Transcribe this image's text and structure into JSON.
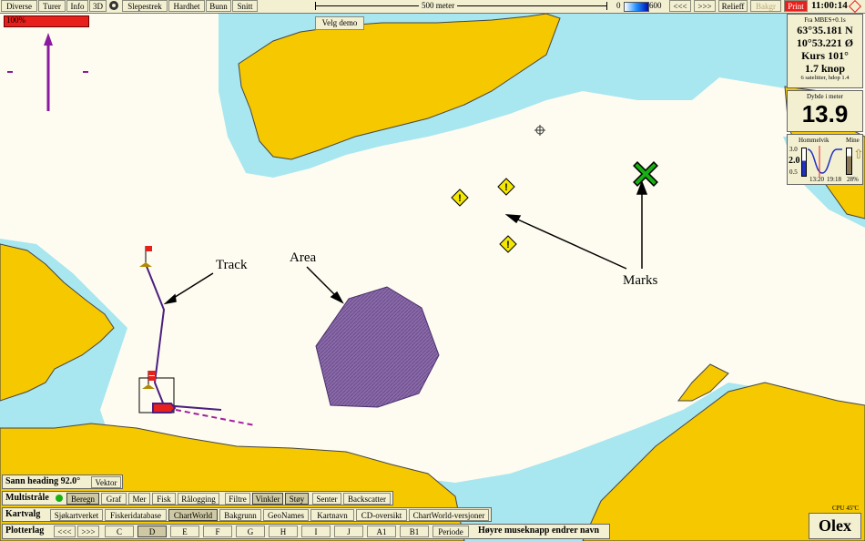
{
  "colors": {
    "land": "#f5c800",
    "shallow": "#a8e6f0",
    "water": "#fefcf0",
    "area": "#8a6aa8",
    "track": "#4a1f7f",
    "panel": "#f3f0d2",
    "red": "#e8201c",
    "green": "#17b012"
  },
  "topbar": {
    "menu": [
      "Diverse",
      "Turer",
      "Info",
      "3D",
      "Slepestrek",
      "Hardhet",
      "Bunn",
      "Snitt"
    ],
    "scale_label": "500 meter",
    "depth_min": "0",
    "depth_max": "600",
    "prev": "<<<",
    "next": ">>>",
    "relieff": "Relieff",
    "bakgr": "Bakgr",
    "print": "Print",
    "clock": "11:00:14"
  },
  "zoom_label": "100%",
  "demo_button": "Velg demo",
  "gps": {
    "line1": "Fra MBES+0.1s",
    "lat": "63°35.181 N",
    "lon": "10°53.221 Ø",
    "course": "Kurs 101°",
    "speed": "1.7 knop",
    "sats": "6 satelitter, hdop 1.4"
  },
  "depth": {
    "label": "Dybde i meter",
    "value": "13.9"
  },
  "tide": {
    "place": "Hommelvik",
    "moon": "Mine",
    "v_top": "3.0",
    "v_mid": "2.0",
    "v_bot": "0.5",
    "t1": "13:20",
    "t2": "19:18",
    "pct": "28%"
  },
  "annotations": {
    "track": "Track",
    "area": "Area",
    "marks": "Marks"
  },
  "heading": {
    "label": "Sann heading 92.0°",
    "vektor": "Vektor"
  },
  "multistraale": {
    "label": "Multistråle",
    "items": [
      "Beregn",
      "Graf",
      "Mer",
      "Fisk",
      "Rålogging",
      "Filtre",
      "Vinkler",
      "Støy",
      "Senter",
      "Backscatter"
    ]
  },
  "kartvalg": {
    "label": "Kartvalg",
    "items": [
      "Sjøkartverket",
      "Fiskeridatabase",
      "ChartWorld",
      "Bakgrunn",
      "GeoNames",
      "Kartnavn",
      "CD-oversikt",
      "ChartWorld-versjoner"
    ]
  },
  "plotterlag": {
    "label": "Plotterlag",
    "prev": "<<<",
    "next": ">>>",
    "items": [
      "C",
      "D",
      "E",
      "F",
      "G",
      "H",
      "I",
      "J",
      "A1",
      "B1",
      "Periode"
    ],
    "hint": "Høyre museknapp endrer navn"
  },
  "cpu": "CPU 45ºC",
  "brand": "Olex"
}
